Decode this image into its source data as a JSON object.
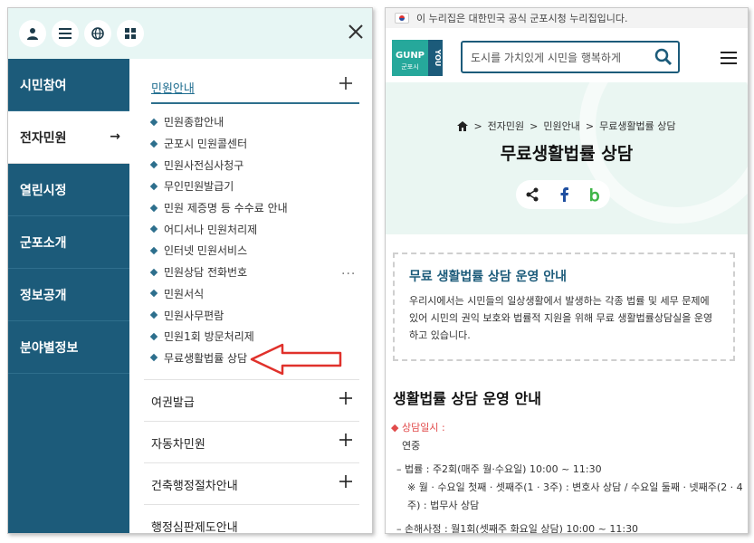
{
  "left_panel": {
    "categories": [
      {
        "label": "시민참여"
      },
      {
        "label": "전자민원",
        "active_arrow": "→"
      },
      {
        "label": "열린시정"
      },
      {
        "label": "군포소개"
      },
      {
        "label": "정보공개"
      },
      {
        "label": "분야별정보"
      }
    ],
    "submenu_title": "민원안내",
    "submenu_items": [
      "민원종합안내",
      "군포시 민원콜센터",
      "민원사전심사청구",
      "무인민원발급기",
      "민원 제증명 등 수수료 안내",
      "어디서나 민원처리제",
      "인터넷 민원서비스",
      "민원상담 전화번호",
      "민원서식",
      "민원사무편람",
      "민원1회 방문처리제",
      "무료생활법률 상담"
    ],
    "more": "···",
    "accordions": [
      "여권발급",
      "자동차민원",
      "건축행정절차안내",
      "행정심판제도안내"
    ]
  },
  "right_panel": {
    "gov_notice": "이 누리집은 대한민국 공식 군포시청 누리집입니다.",
    "logo_text": "GUNP",
    "logo_sub": "군포시",
    "logo_side": "YOU",
    "search_placeholder": "도시를 가치있게 시민을 행복하게",
    "breadcrumb": [
      "전자민원",
      "민원안내",
      "무료생활법률 상담"
    ],
    "page_title": "무료생활법률 상담",
    "notice": {
      "title": "무료 생활법률 상담 운영 안내",
      "body": "우리시에서는 시민들의 일상생활에서 발생하는 각종 법률 및 세무 문제에 있어 시민의 권익 보호와 법률적 지원을 위해 무료 생활법률상담실을 운영하고 있습니다."
    },
    "section_title": "생활법률 상담 운영 안내",
    "details": {
      "schedule_label": "상담일시 :",
      "schedule_value": "연중",
      "line1": "법률 : 주2회(매주 월·수요일) 10:00 ~ 11:30",
      "line2": "※ 월 · 수요일 첫째 · 셋째주(1 · 3주) : 변호사 상담 / 수요일 둘째 · 넷째주(2 · 4",
      "line3": "주) : 법무사 상담",
      "line4": "손해사정 : 월1회(셋째주 화요일 상담) 10:00 ~ 11:30"
    }
  },
  "colors": {
    "navy": "#1c5b7a",
    "mint": "#e7f6f4",
    "red_arrow": "#e0312b",
    "accent_text": "#1f6d8f"
  }
}
